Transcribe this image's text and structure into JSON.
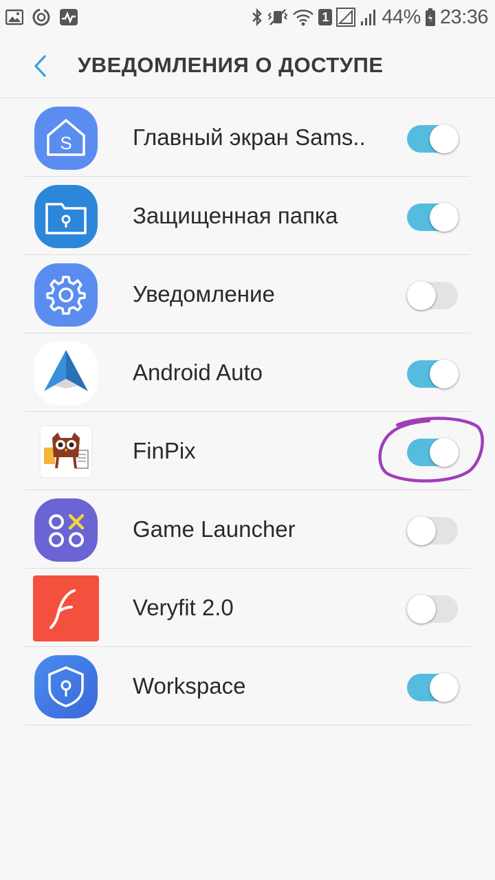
{
  "status_bar": {
    "battery_percent": "44%",
    "time": "23:36",
    "sim_badge": "1",
    "left_icons": [
      "image-icon",
      "refresh-circle-icon",
      "activity-icon"
    ],
    "right_icons": [
      "bluetooth-icon",
      "vibrate-icon",
      "wifi-icon",
      "signal-icon",
      "battery-icon"
    ]
  },
  "header": {
    "title": "УВЕДОМЛЕНИЯ О ДОСТУПЕ",
    "back_icon": "chevron-left-icon"
  },
  "colors": {
    "toggle_on": "#55bce0",
    "toggle_off": "#e3e3e3",
    "highlight_circle": "#a03fb8",
    "accent": "#3aa0d8"
  },
  "apps": [
    {
      "label": "Главный экран Sams..",
      "enabled": true,
      "icon": "samsung-home-icon"
    },
    {
      "label": "Защищенная папка",
      "enabled": true,
      "icon": "secure-folder-icon"
    },
    {
      "label": "Уведомление",
      "enabled": false,
      "icon": "settings-gear-icon"
    },
    {
      "label": "Android Auto",
      "enabled": true,
      "icon": "android-auto-icon"
    },
    {
      "label": "FinPix",
      "enabled": true,
      "icon": "finpix-owl-icon"
    },
    {
      "label": "Game Launcher",
      "enabled": false,
      "icon": "game-launcher-icon"
    },
    {
      "label": "Veryfit 2.0",
      "enabled": false,
      "icon": "veryfit-icon"
    },
    {
      "label": "Workspace",
      "enabled": true,
      "icon": "workspace-shield-icon"
    }
  ]
}
